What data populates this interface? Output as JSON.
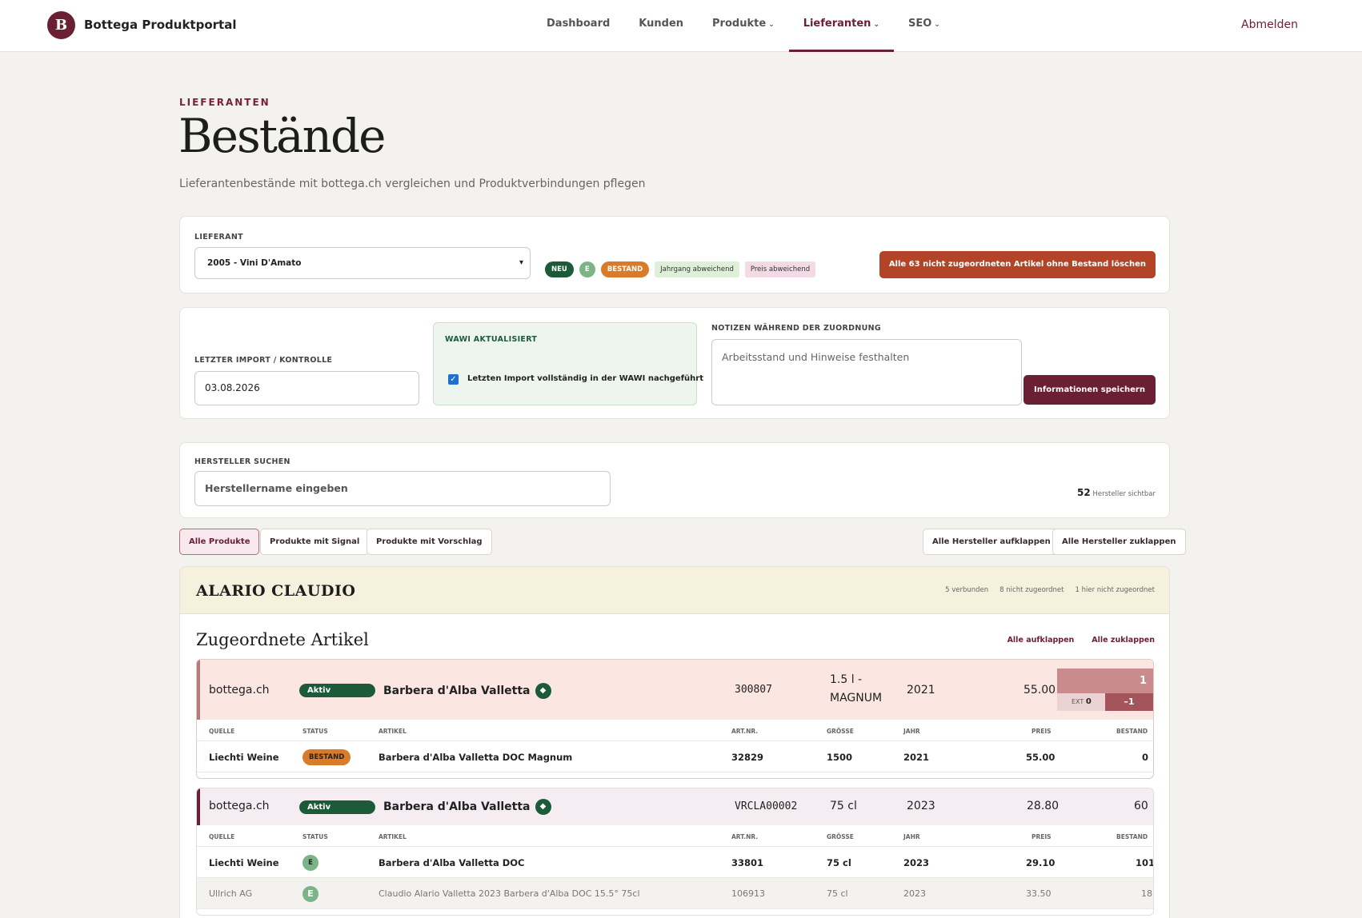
{
  "nav": {
    "logo_letter": "B",
    "brand": "Bottega Produktportal",
    "items": [
      {
        "label": "Dashboard",
        "chevron": false,
        "active": false
      },
      {
        "label": "Kunden",
        "chevron": false,
        "active": false
      },
      {
        "label": "Produkte",
        "chevron": true,
        "active": false
      },
      {
        "label": "Lieferanten",
        "chevron": true,
        "active": true
      },
      {
        "label": "SEO",
        "chevron": true,
        "active": false
      }
    ],
    "chevron_glyph": "⌄",
    "logout": "Abmelden"
  },
  "header": {
    "eyebrow": "LIEFERANTEN",
    "title": "Bestände",
    "subtitle": "Lieferantenbestände mit bottega.ch vergleichen und Produktverbindungen pflegen"
  },
  "supplier_card": {
    "label": "LIEFERANT",
    "selected": "2005 - Vini D'Amato",
    "legend": {
      "neu": "NEU",
      "e": "E",
      "bestand": "BESTAND",
      "jahrgang": "Jahrgang abweichend",
      "preis": "Preis abweichend"
    },
    "delete_button": "Alle 63 nicht zugeordneten Artikel ohne Bestand löschen"
  },
  "import_card": {
    "import_label": "LETZTER IMPORT / KONTROLLE",
    "import_date": "03.08.2026",
    "wawi_label": "WAWI AKTUALISIERT",
    "wawi_check_label": "Letzten Import vollständig in der WAWI nachgeführt",
    "wawi_checked": true,
    "notes_label": "NOTIZEN WÄHREND DER ZUORDNUNG",
    "notes_placeholder": "Arbeitsstand und Hinweise festhalten",
    "save_button": "Informationen speichern"
  },
  "search_card": {
    "label": "HERSTELLER SUCHEN",
    "placeholder": "Herstellername eingeben",
    "count": "52",
    "count_suffix": "Hersteller sichtbar"
  },
  "filters": {
    "all": "Alle Produkte",
    "signal": "Produkte mit Signal",
    "vorschlag": "Produkte mit Vorschlag",
    "expand_all": "Alle Hersteller aufklappen",
    "collapse_all": "Alle Hersteller zuklappen"
  },
  "producer": {
    "name": "ALARIO CLAUDIO",
    "stat_verbunden": "5 verbunden",
    "stat_nicht": "8 nicht zugeordnet",
    "stat_hier": "1 hier nicht zugeordnet",
    "section_title": "Zugeordnete Artikel",
    "expand": "Alle aufklappen",
    "collapse": "Alle zuklappen",
    "columns": {
      "quelle": "QUELLE",
      "status": "STATUS",
      "artikel": "ARTIKEL",
      "artnr": "ART.NR.",
      "groesse": "GRÖSSE",
      "jahr": "JAHR",
      "preis": "PREIS",
      "bestand": "BESTAND"
    },
    "items": [
      {
        "source": "bottega.ch",
        "status": "Aktiv",
        "name": "Barbera d'Alba Valletta",
        "artnr": "300807",
        "size_line1": "1.5 l -",
        "size_line2": "MAGNUM",
        "year": "2021",
        "price": "55.00",
        "stock": "1",
        "ext_label": "EXT",
        "ext_value": "0",
        "diff": "–1",
        "rows": [
          {
            "source": "Liechti Weine",
            "status": "BESTAND",
            "article": "Barbera d'Alba Valletta DOC Magnum",
            "artnr": "32829",
            "size": "1500",
            "year": "2021",
            "price": "55.00",
            "stock": "0"
          }
        ]
      },
      {
        "source": "bottega.ch",
        "status": "Aktiv",
        "name": "Barbera d'Alba Valletta",
        "artnr": "VRCLA00002",
        "size": "75 cl",
        "year": "2023",
        "price": "28.80",
        "stock": "60",
        "rows": [
          {
            "source": "Liechti Weine",
            "status": "E",
            "article": "Barbera d'Alba Valletta DOC",
            "artnr": "33801",
            "size": "75 cl",
            "year": "2023",
            "price": "29.10",
            "stock": "101"
          },
          {
            "source": "Ullrich AG",
            "status": "E",
            "article": "Claudio Alario Valletta 2023 Barbera d'Alba DOC 15.5° 75cl",
            "artnr": "106913",
            "size": "75 cl",
            "year": "2023",
            "price": "33.50",
            "stock": "18"
          }
        ]
      }
    ]
  },
  "colors": {
    "brand": "#6b1f35",
    "green": "#1c5b3a",
    "orange": "#d97b29",
    "danger": "#b34427"
  }
}
